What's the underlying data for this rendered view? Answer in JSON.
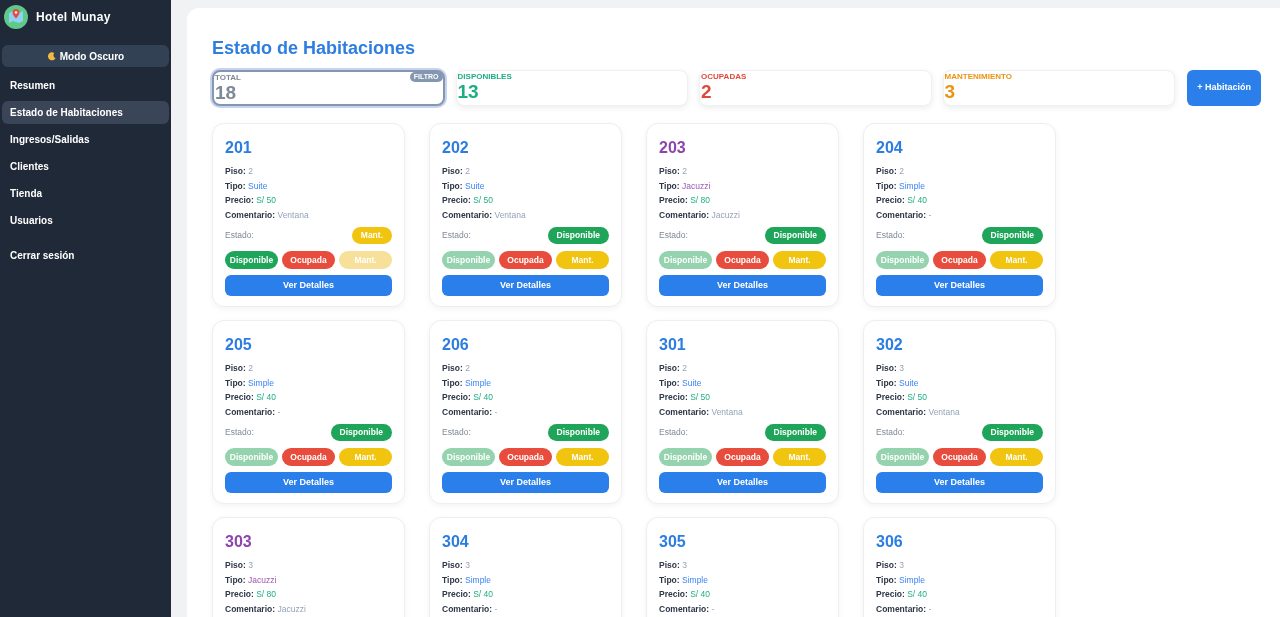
{
  "sidebar": {
    "brand": "Hotel Munay",
    "theme_button": "Modo Oscuro",
    "items": [
      {
        "label": "Resumen",
        "selected": false
      },
      {
        "label": "Estado de Habitaciones",
        "selected": true
      },
      {
        "label": "Ingresos/Salidas",
        "selected": false
      },
      {
        "label": "Clientes",
        "selected": false
      },
      {
        "label": "Tienda",
        "selected": false
      },
      {
        "label": "Usuarios",
        "selected": false
      }
    ],
    "logout": "Cerrar sesión"
  },
  "page_title": "Estado de Habitaciones",
  "stats": [
    {
      "kind": "total",
      "label": "TOTAL",
      "value": "18",
      "badge": "FILTRO",
      "selected": true
    },
    {
      "kind": "available",
      "label": "DISPONIBLES",
      "value": "13",
      "selected": false
    },
    {
      "kind": "occupied",
      "label": "OCUPADAS",
      "value": "2",
      "selected": false
    },
    {
      "kind": "maintenance",
      "label": "MANTENIMIENTO",
      "value": "3",
      "selected": false
    }
  ],
  "add_button": "+ Habitación",
  "rooms": [
    {
      "number": "201",
      "kind": "standard",
      "fields": [
        {
          "kind": "floor",
          "label": "Piso:",
          "value": "2"
        },
        {
          "kind": "type",
          "label": "Tipo:",
          "value": "Suite"
        },
        {
          "kind": "price",
          "label": "Precio:",
          "value": "S/ 50"
        },
        {
          "kind": "comment",
          "label": "Comentario:",
          "value": "Ventana"
        }
      ],
      "status": {
        "label": "Estado:",
        "badge": "Mant.",
        "kind": "maintenance"
      },
      "actions": [
        {
          "label": "Disponible",
          "kind": "available",
          "selected": false
        },
        {
          "label": "Ocupada",
          "kind": "occupied",
          "selected": false
        },
        {
          "label": "Mant.",
          "kind": "maintenance",
          "selected": true
        }
      ],
      "details": "Ver Detalles"
    },
    {
      "number": "202",
      "kind": "standard",
      "fields": [
        {
          "kind": "floor",
          "label": "Piso:",
          "value": "2"
        },
        {
          "kind": "type",
          "label": "Tipo:",
          "value": "Suite"
        },
        {
          "kind": "price",
          "label": "Precio:",
          "value": "S/ 50"
        },
        {
          "kind": "comment",
          "label": "Comentario:",
          "value": "Ventana"
        }
      ],
      "status": {
        "label": "Estado:",
        "badge": "Disponible",
        "kind": "available"
      },
      "actions": [
        {
          "label": "Disponible",
          "kind": "available",
          "selected": true
        },
        {
          "label": "Ocupada",
          "kind": "occupied",
          "selected": false
        },
        {
          "label": "Mant.",
          "kind": "maintenance",
          "selected": false
        }
      ],
      "details": "Ver Detalles"
    },
    {
      "number": "203",
      "kind": "jacuzzi",
      "fields": [
        {
          "kind": "floor",
          "label": "Piso:",
          "value": "2"
        },
        {
          "kind": "type",
          "label": "Tipo:",
          "value": "Jacuzzi"
        },
        {
          "kind": "price",
          "label": "Precio:",
          "value": "S/ 80"
        },
        {
          "kind": "comment",
          "label": "Comentario:",
          "value": "Jacuzzi"
        }
      ],
      "status": {
        "label": "Estado:",
        "badge": "Disponible",
        "kind": "available"
      },
      "actions": [
        {
          "label": "Disponible",
          "kind": "available",
          "selected": true
        },
        {
          "label": "Ocupada",
          "kind": "occupied",
          "selected": false
        },
        {
          "label": "Mant.",
          "kind": "maintenance",
          "selected": false
        }
      ],
      "details": "Ver Detalles"
    },
    {
      "number": "204",
      "kind": "standard",
      "fields": [
        {
          "kind": "floor",
          "label": "Piso:",
          "value": "2"
        },
        {
          "kind": "type",
          "label": "Tipo:",
          "value": "Simple"
        },
        {
          "kind": "price",
          "label": "Precio:",
          "value": "S/ 40"
        },
        {
          "kind": "comment",
          "label": "Comentario:",
          "value": "-"
        }
      ],
      "status": {
        "label": "Estado:",
        "badge": "Disponible",
        "kind": "available"
      },
      "actions": [
        {
          "label": "Disponible",
          "kind": "available",
          "selected": true
        },
        {
          "label": "Ocupada",
          "kind": "occupied",
          "selected": false
        },
        {
          "label": "Mant.",
          "kind": "maintenance",
          "selected": false
        }
      ],
      "details": "Ver Detalles"
    },
    {
      "number": "205",
      "kind": "standard",
      "fields": [
        {
          "kind": "floor",
          "label": "Piso:",
          "value": "2"
        },
        {
          "kind": "type",
          "label": "Tipo:",
          "value": "Simple"
        },
        {
          "kind": "price",
          "label": "Precio:",
          "value": "S/ 40"
        },
        {
          "kind": "comment",
          "label": "Comentario:",
          "value": "-"
        }
      ],
      "status": {
        "label": "Estado:",
        "badge": "Disponible",
        "kind": "available"
      },
      "actions": [
        {
          "label": "Disponible",
          "kind": "available",
          "selected": true
        },
        {
          "label": "Ocupada",
          "kind": "occupied",
          "selected": false
        },
        {
          "label": "Mant.",
          "kind": "maintenance",
          "selected": false
        }
      ],
      "details": "Ver Detalles"
    },
    {
      "number": "206",
      "kind": "standard",
      "fields": [
        {
          "kind": "floor",
          "label": "Piso:",
          "value": "2"
        },
        {
          "kind": "type",
          "label": "Tipo:",
          "value": "Simple"
        },
        {
          "kind": "price",
          "label": "Precio:",
          "value": "S/ 40"
        },
        {
          "kind": "comment",
          "label": "Comentario:",
          "value": "-"
        }
      ],
      "status": {
        "label": "Estado:",
        "badge": "Disponible",
        "kind": "available"
      },
      "actions": [
        {
          "label": "Disponible",
          "kind": "available",
          "selected": true
        },
        {
          "label": "Ocupada",
          "kind": "occupied",
          "selected": false
        },
        {
          "label": "Mant.",
          "kind": "maintenance",
          "selected": false
        }
      ],
      "details": "Ver Detalles"
    },
    {
      "number": "301",
      "kind": "standard",
      "fields": [
        {
          "kind": "floor",
          "label": "Piso:",
          "value": "2"
        },
        {
          "kind": "type",
          "label": "Tipo:",
          "value": "Suite"
        },
        {
          "kind": "price",
          "label": "Precio:",
          "value": "S/ 50"
        },
        {
          "kind": "comment",
          "label": "Comentario:",
          "value": "Ventana"
        }
      ],
      "status": {
        "label": "Estado:",
        "badge": "Disponible",
        "kind": "available"
      },
      "actions": [
        {
          "label": "Disponible",
          "kind": "available",
          "selected": true
        },
        {
          "label": "Ocupada",
          "kind": "occupied",
          "selected": false
        },
        {
          "label": "Mant.",
          "kind": "maintenance",
          "selected": false
        }
      ],
      "details": "Ver Detalles"
    },
    {
      "number": "302",
      "kind": "standard",
      "fields": [
        {
          "kind": "floor",
          "label": "Piso:",
          "value": "3"
        },
        {
          "kind": "type",
          "label": "Tipo:",
          "value": "Suite"
        },
        {
          "kind": "price",
          "label": "Precio:",
          "value": "S/ 50"
        },
        {
          "kind": "comment",
          "label": "Comentario:",
          "value": "Ventana"
        }
      ],
      "status": {
        "label": "Estado:",
        "badge": "Disponible",
        "kind": "available"
      },
      "actions": [
        {
          "label": "Disponible",
          "kind": "available",
          "selected": true
        },
        {
          "label": "Ocupada",
          "kind": "occupied",
          "selected": false
        },
        {
          "label": "Mant.",
          "kind": "maintenance",
          "selected": false
        }
      ],
      "details": "Ver Detalles"
    },
    {
      "number": "303",
      "kind": "jacuzzi",
      "fields": [
        {
          "kind": "floor",
          "label": "Piso:",
          "value": "3"
        },
        {
          "kind": "type",
          "label": "Tipo:",
          "value": "Jacuzzi"
        },
        {
          "kind": "price",
          "label": "Precio:",
          "value": "S/ 80"
        },
        {
          "kind": "comment",
          "label": "Comentario:",
          "value": "Jacuzzi"
        }
      ]
    },
    {
      "number": "304",
      "kind": "standard",
      "fields": [
        {
          "kind": "floor",
          "label": "Piso:",
          "value": "3"
        },
        {
          "kind": "type",
          "label": "Tipo:",
          "value": "Simple"
        },
        {
          "kind": "price",
          "label": "Precio:",
          "value": "S/ 40"
        },
        {
          "kind": "comment",
          "label": "Comentario:",
          "value": "-"
        }
      ]
    },
    {
      "number": "305",
      "kind": "standard",
      "fields": [
        {
          "kind": "floor",
          "label": "Piso:",
          "value": "3"
        },
        {
          "kind": "type",
          "label": "Tipo:",
          "value": "Simple"
        },
        {
          "kind": "price",
          "label": "Precio:",
          "value": "S/ 40"
        },
        {
          "kind": "comment",
          "label": "Comentario:",
          "value": "-"
        }
      ]
    },
    {
      "number": "306",
      "kind": "standard",
      "fields": [
        {
          "kind": "floor",
          "label": "Piso:",
          "value": "3"
        },
        {
          "kind": "type",
          "label": "Tipo:",
          "value": "Simple"
        },
        {
          "kind": "price",
          "label": "Precio:",
          "value": "S/ 40"
        },
        {
          "kind": "comment",
          "label": "Comentario:",
          "value": "-"
        }
      ]
    }
  ]
}
